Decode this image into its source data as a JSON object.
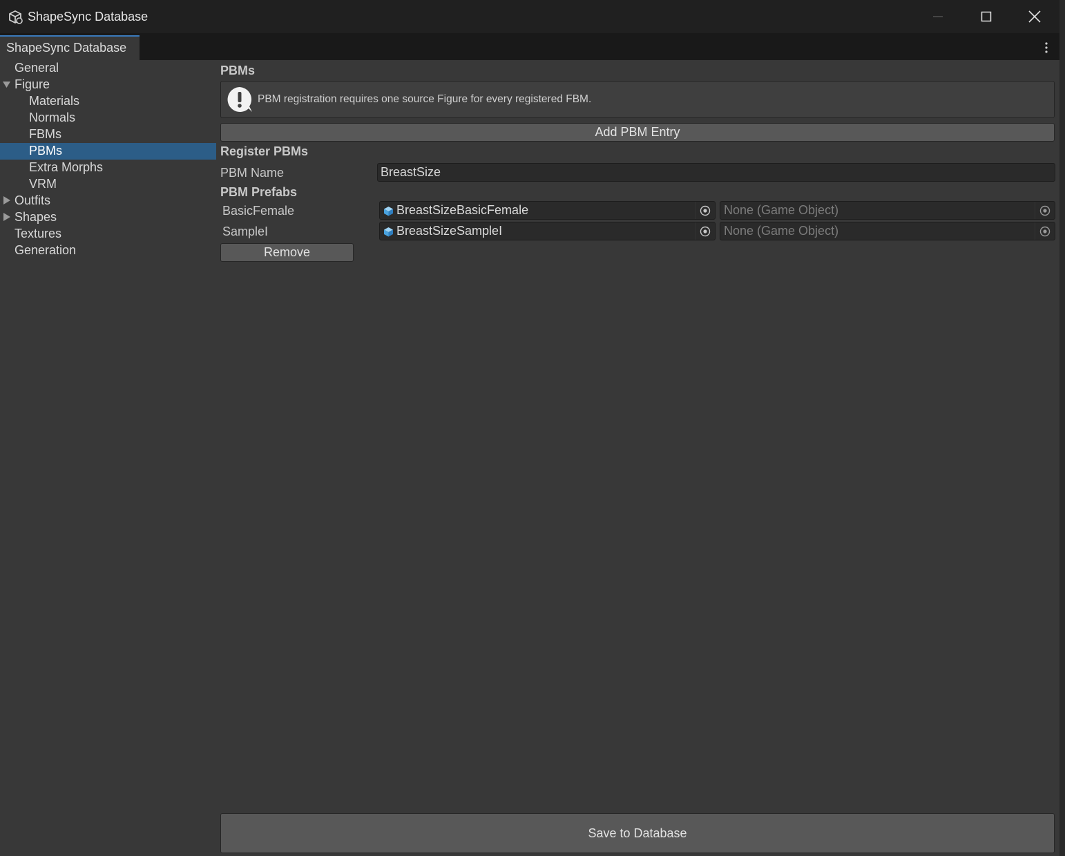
{
  "window": {
    "title": "ShapeSync Database",
    "tab_label": "ShapeSync Database"
  },
  "sidebar": {
    "items": [
      {
        "label": "General",
        "level": 0,
        "expander": "none",
        "selected": false
      },
      {
        "label": "Figure",
        "level": 0,
        "expander": "expanded",
        "selected": false
      },
      {
        "label": "Materials",
        "level": 1,
        "expander": "none",
        "selected": false
      },
      {
        "label": "Normals",
        "level": 1,
        "expander": "none",
        "selected": false
      },
      {
        "label": "FBMs",
        "level": 1,
        "expander": "none",
        "selected": false
      },
      {
        "label": "PBMs",
        "level": 1,
        "expander": "none",
        "selected": true
      },
      {
        "label": "Extra Morphs",
        "level": 1,
        "expander": "none",
        "selected": false
      },
      {
        "label": "VRM",
        "level": 1,
        "expander": "none",
        "selected": false
      },
      {
        "label": "Outfits",
        "level": 0,
        "expander": "collapsed",
        "selected": false
      },
      {
        "label": "Shapes",
        "level": 0,
        "expander": "collapsed",
        "selected": false
      },
      {
        "label": "Textures",
        "level": 0,
        "expander": "none",
        "selected": false
      },
      {
        "label": "Generation",
        "level": 0,
        "expander": "none",
        "selected": false
      }
    ]
  },
  "main": {
    "section_title": "PBMs",
    "help_message": "PBM registration requires one source Figure for every registered FBM.",
    "add_button_label": "Add PBM Entry",
    "register_title": "Register PBMs",
    "pbm_name_label": "PBM Name",
    "pbm_name_value": "BreastSize",
    "prefabs_title": "PBM Prefabs",
    "prefabs": [
      {
        "figure": "BasicFemale",
        "prefab": "BreastSizeBasicFemale",
        "target": "None (Game Object)"
      },
      {
        "figure": "SampleI",
        "prefab": "BreastSizeSampleI",
        "target": "None (Game Object)"
      }
    ],
    "remove_button_label": "Remove",
    "save_button_label": "Save to Database"
  },
  "colors": {
    "accent": "#2c5d87",
    "tab_accent": "#3a79bb",
    "background": "#383838"
  }
}
